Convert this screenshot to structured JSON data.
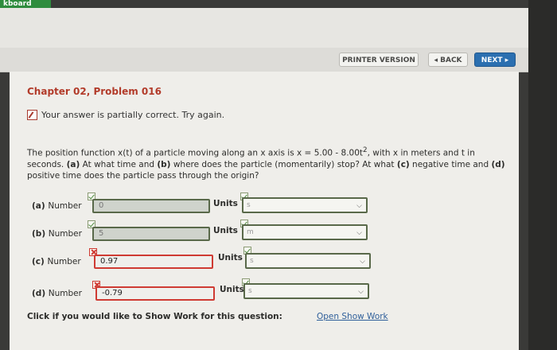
{
  "top_tab": {
    "label": "kboard"
  },
  "toolbar": {
    "printer_label": "PRINTER VERSION",
    "back_label": "◂ BACK",
    "next_label": "NEXT ▸"
  },
  "problem": {
    "chapter_title": "Chapter 02, Problem 016",
    "status_message": "Your answer is partially correct.  Try again.",
    "question": {
      "p1": "The position function x(t) of a particle moving along an x axis is x = 5.00 - 8.00t",
      "p1_sup": "2",
      "p2": ", with x in meters and t in seconds. ",
      "a_tag": "(a)",
      "p3": " At what time and ",
      "b_tag": "(b)",
      "p4": " where does the particle (momentarily) stop? At what ",
      "c_tag": "(c)",
      "p5": " negative time and ",
      "d_tag": "(d)",
      "p6": " positive time does the particle pass through the origin?"
    }
  },
  "answers": [
    {
      "tag": "(a)",
      "label": "Number",
      "value": "0",
      "units_label": "Units",
      "units_value": "s",
      "correct": true
    },
    {
      "tag": "(b)",
      "label": "Number",
      "value": "5",
      "units_label": "Units",
      "units_value": "m",
      "correct": true
    },
    {
      "tag": "(c)",
      "label": "Number",
      "value": "0.97",
      "units_label": "Units",
      "units_value": "s",
      "correct": false
    },
    {
      "tag": "(d)",
      "label": "Number",
      "value": "-0.79",
      "units_label": "Units",
      "units_value": "s",
      "correct": false
    }
  ],
  "show_work": {
    "prompt": "Click if you would like to Show Work for this question:",
    "link_label": "Open Show Work"
  },
  "colors": {
    "correct": "#59694a",
    "incorrect": "#cf3b33",
    "chapter": "#b23b2a",
    "next_button": "#2b6fb0"
  },
  "icons": {
    "status": "pencil-icon",
    "check": "check-icon",
    "cross": "x-icon",
    "dropdown": "chevron-down-icon"
  }
}
